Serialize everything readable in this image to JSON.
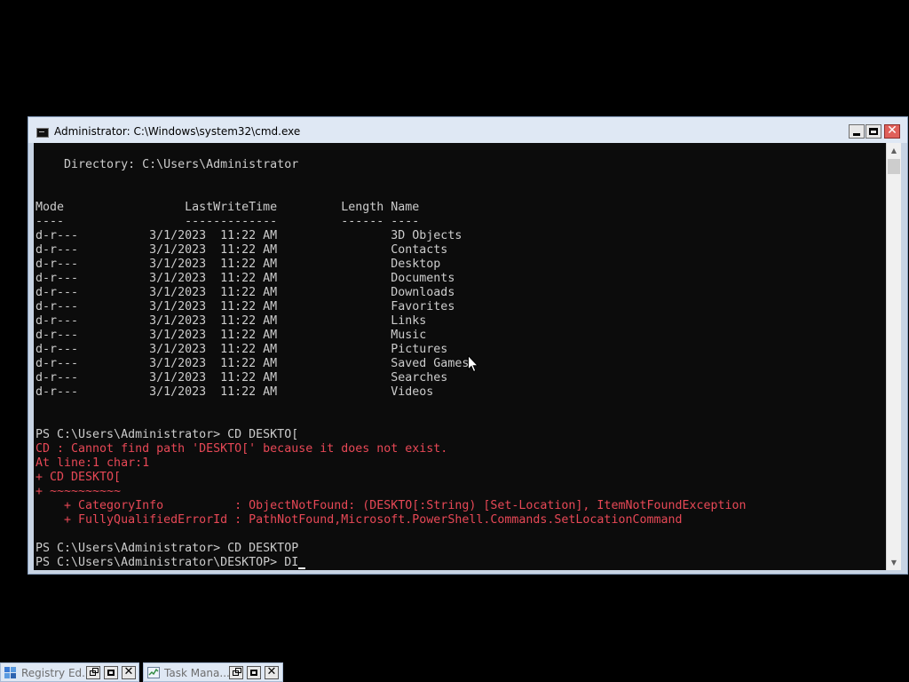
{
  "window": {
    "title": "Administrator: C:\\Windows\\system32\\cmd.exe",
    "minimize_icon": "minimize-icon",
    "maximize_icon": "maximize-icon",
    "close_label": "✕"
  },
  "console": {
    "lines": [
      {
        "text": "    Directory: C:\\Users\\Administrator",
        "style": "normal"
      },
      {
        "text": "",
        "style": "normal"
      },
      {
        "text": "",
        "style": "normal"
      },
      {
        "text": "Mode                 LastWriteTime         Length Name",
        "style": "normal"
      },
      {
        "text": "----                 -------------         ------ ----",
        "style": "normal"
      },
      {
        "text": "d-r---          3/1/2023  11:22 AM                3D Objects",
        "style": "normal"
      },
      {
        "text": "d-r---          3/1/2023  11:22 AM                Contacts",
        "style": "normal"
      },
      {
        "text": "d-r---          3/1/2023  11:22 AM                Desktop",
        "style": "normal"
      },
      {
        "text": "d-r---          3/1/2023  11:22 AM                Documents",
        "style": "normal"
      },
      {
        "text": "d-r---          3/1/2023  11:22 AM                Downloads",
        "style": "normal"
      },
      {
        "text": "d-r---          3/1/2023  11:22 AM                Favorites",
        "style": "normal"
      },
      {
        "text": "d-r---          3/1/2023  11:22 AM                Links",
        "style": "normal"
      },
      {
        "text": "d-r---          3/1/2023  11:22 AM                Music",
        "style": "normal"
      },
      {
        "text": "d-r---          3/1/2023  11:22 AM                Pictures",
        "style": "normal"
      },
      {
        "text": "d-r---          3/1/2023  11:22 AM                Saved Games",
        "style": "normal"
      },
      {
        "text": "d-r---          3/1/2023  11:22 AM                Searches",
        "style": "normal"
      },
      {
        "text": "d-r---          3/1/2023  11:22 AM                Videos",
        "style": "normal"
      },
      {
        "text": "",
        "style": "normal"
      },
      {
        "text": "",
        "style": "normal"
      },
      {
        "text": "PS C:\\Users\\Administrator> CD DESKTO[",
        "style": "normal"
      },
      {
        "text": "CD : Cannot find path 'DESKTO[' because it does not exist.",
        "style": "error"
      },
      {
        "text": "At line:1 char:1",
        "style": "error"
      },
      {
        "text": "+ CD DESKTO[",
        "style": "error"
      },
      {
        "text": "+ ~~~~~~~~~~",
        "style": "error"
      },
      {
        "text": "    + CategoryInfo          : ObjectNotFound: (DESKTO[:String) [Set-Location], ItemNotFoundException",
        "style": "error"
      },
      {
        "text": "    + FullyQualifiedErrorId : PathNotFound,Microsoft.PowerShell.Commands.SetLocationCommand",
        "style": "error"
      },
      {
        "text": "",
        "style": "normal"
      },
      {
        "text": "PS C:\\Users\\Administrator> CD DESKTOP",
        "style": "normal"
      },
      {
        "text": "PS C:\\Users\\Administrator\\DESKTOP> DI",
        "style": "normal",
        "caret": true
      }
    ],
    "scroll_up_icon": "▲",
    "scroll_down_icon": "▼"
  },
  "taskbar": {
    "items": [
      {
        "label": "Registry Ed...",
        "icon": "registry-editor-icon"
      },
      {
        "label": "Task Mana...",
        "icon": "task-manager-icon"
      }
    ],
    "close_label": "✕"
  },
  "colors": {
    "console_bg": "#0c0c0c",
    "console_text": "#cccccc",
    "error_text": "#e74856",
    "title_bg": "#dfe8f4",
    "close_button": "#e0605a"
  }
}
